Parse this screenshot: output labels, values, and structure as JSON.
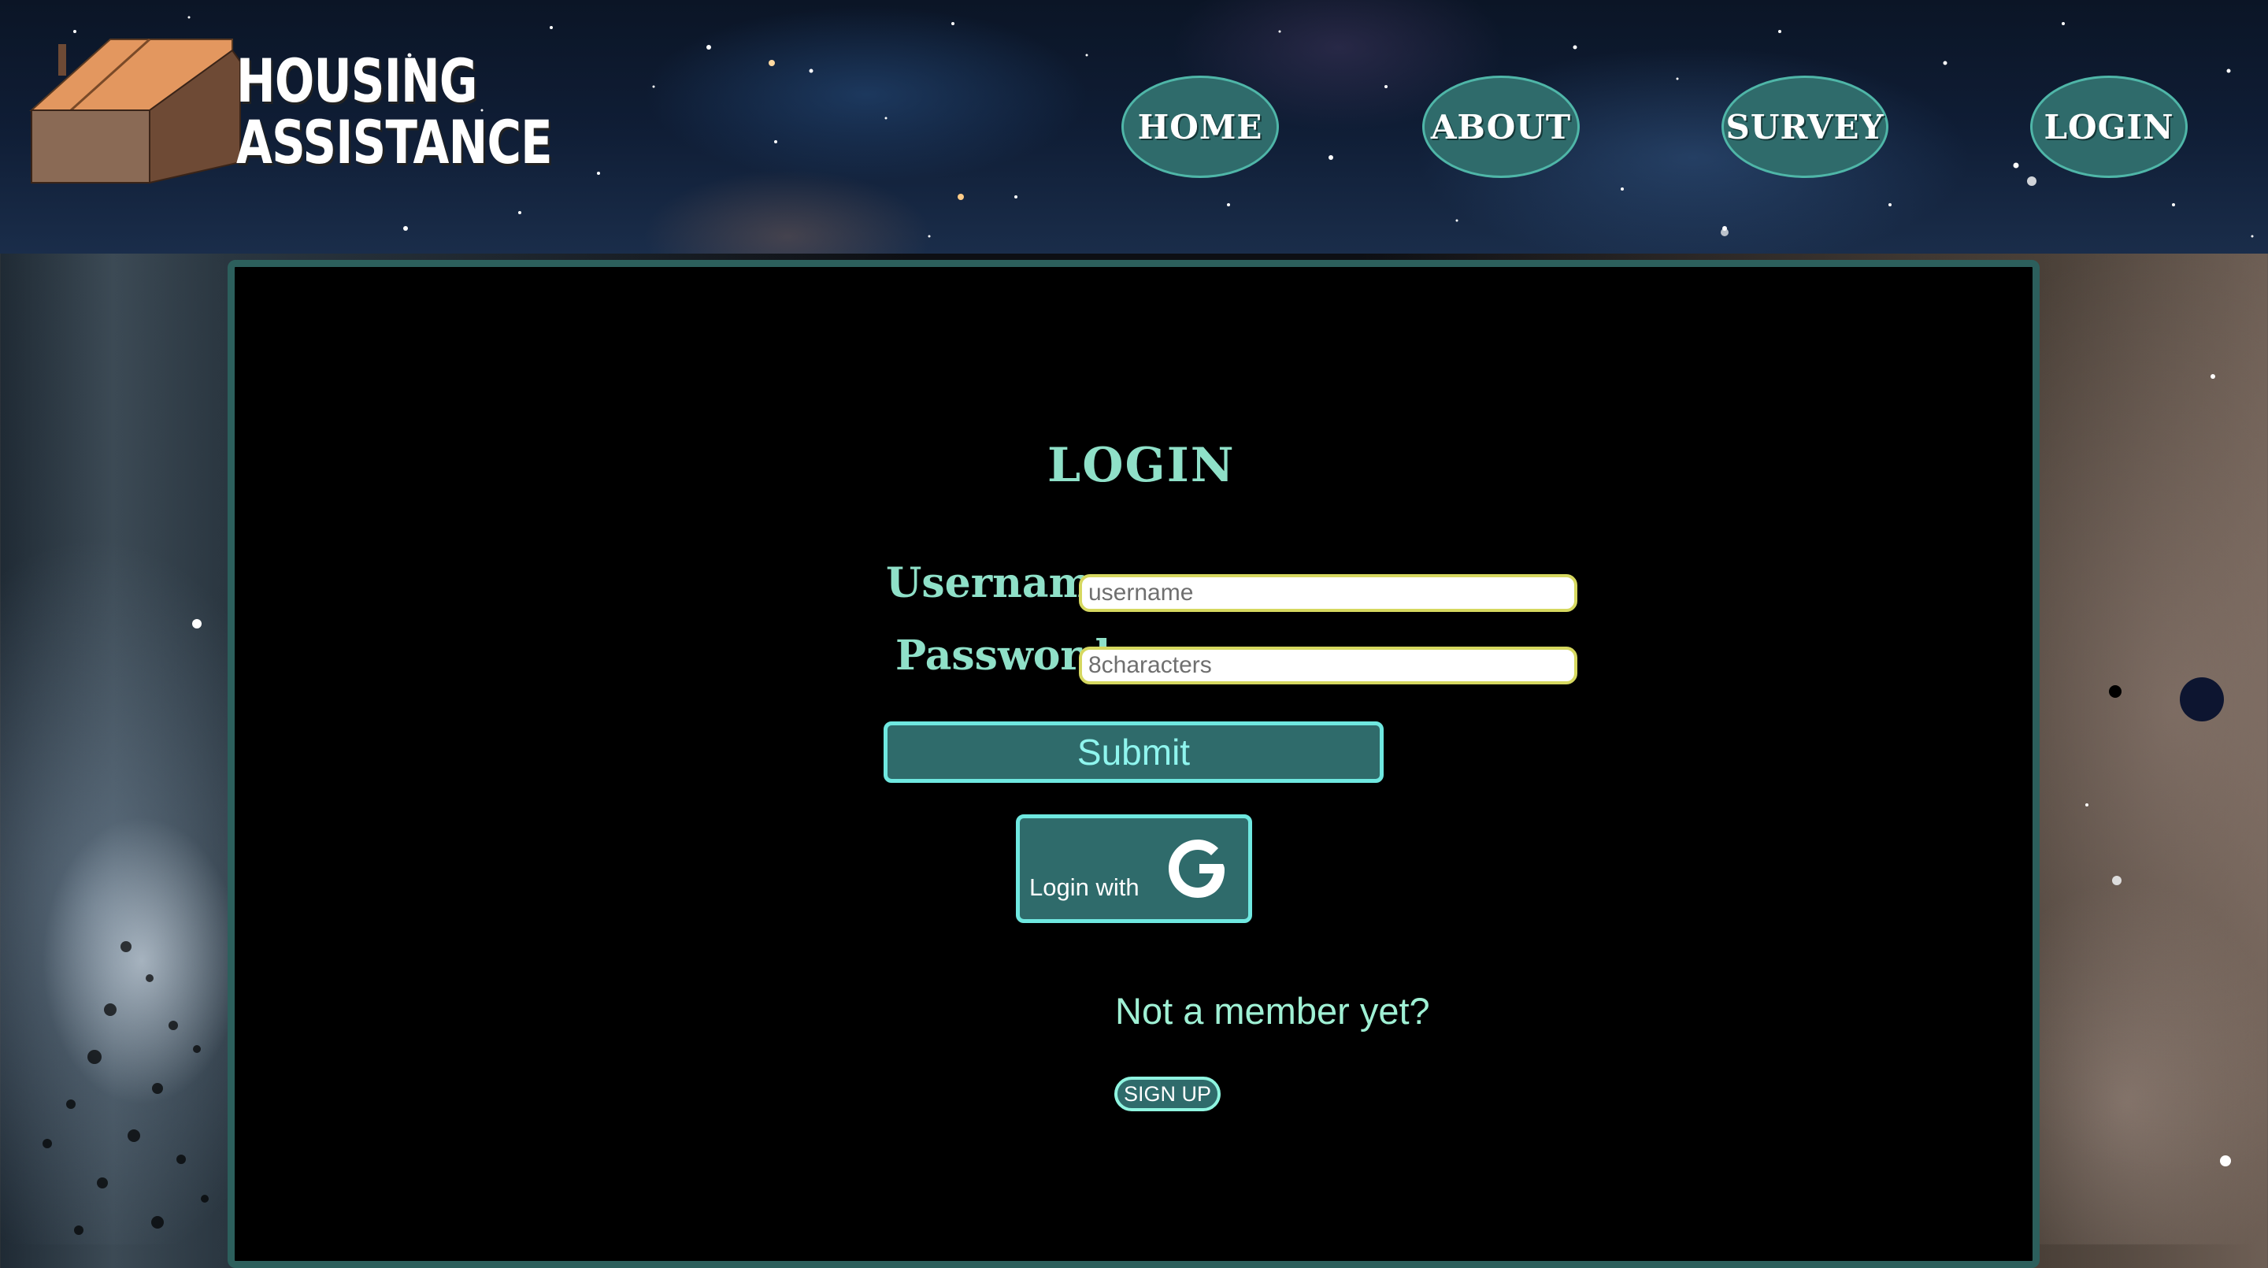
{
  "header": {
    "logo_line1": "HOUSING",
    "logo_line2": "ASSISTANCE",
    "nav": [
      {
        "label": "HOME"
      },
      {
        "label": "ABOUT"
      },
      {
        "label": "SURVEY"
      },
      {
        "label": "LOGIN"
      }
    ]
  },
  "login": {
    "title": "LOGIN",
    "username_label": "Username:",
    "username_placeholder": "username",
    "username_value": "",
    "password_label": "Password:",
    "password_placeholder": "8characters",
    "password_value": "",
    "submit_label": "Submit",
    "google_label": "Login with",
    "member_text": "Not a member yet?",
    "signup_label": "SIGN UP"
  },
  "colors": {
    "accent_teal": "#2f6b6b",
    "text_mint": "#8fe0c8",
    "button_border": "#6fe8e0",
    "input_border": "#d6d860"
  },
  "icons": [
    "house-logo-icon",
    "google-g-icon"
  ]
}
